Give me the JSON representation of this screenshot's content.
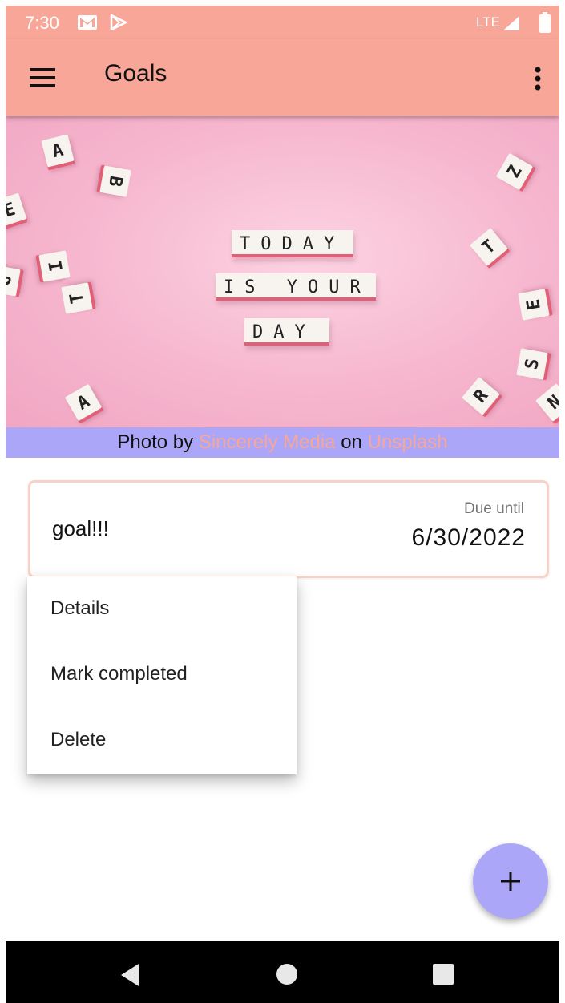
{
  "status_bar": {
    "time": "7:30",
    "network": "LTE",
    "icons": [
      "gmail-icon",
      "play-store-icon",
      "signal-icon",
      "battery-icon"
    ]
  },
  "app_bar": {
    "title": "Goals",
    "icons": [
      "menu-icon",
      "more-vert-icon"
    ]
  },
  "hero": {
    "phrase_lines": [
      "TODAY",
      "IS YOUR",
      "DAY"
    ],
    "scattered_letters": [
      "A",
      "B",
      "E",
      "I",
      "T",
      "G",
      "A",
      "Z",
      "T",
      "E",
      "S",
      "R",
      "N"
    ]
  },
  "photo_credit": {
    "prefix": "Photo by ",
    "author": "Sincerely Media",
    "middle": " on ",
    "source": "Unsplash"
  },
  "goal_card": {
    "name": "goal!!!",
    "due_label": "Due until",
    "due_date": "6/30/2022"
  },
  "popup_menu": {
    "items": [
      "Details",
      "Mark completed",
      "Delete"
    ]
  },
  "fab": {
    "icon": "add-icon"
  },
  "nav_bar": {
    "icons": [
      "back-icon",
      "home-icon",
      "recents-icon"
    ]
  },
  "colors": {
    "app_bar": "#f8a697",
    "credit_bar": "#aca6f8",
    "fab": "#aca6f8",
    "card_border": "#f6d3c6"
  }
}
